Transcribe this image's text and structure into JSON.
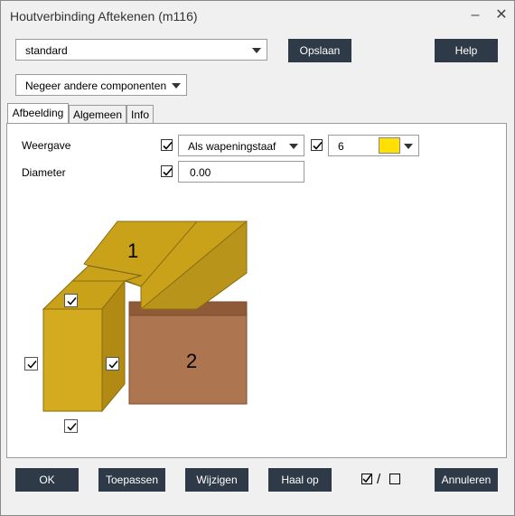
{
  "window": {
    "title": "Houtverbinding Aftekenen (m116)"
  },
  "titlebar": {
    "minimize_glyph": "‒",
    "close_glyph": "✕"
  },
  "top": {
    "preset_value": "standard",
    "save_label": "Opslaan",
    "help_label": "Help",
    "ignore_value": "Negeer andere componenten"
  },
  "tabs": [
    {
      "label": "Afbeelding"
    },
    {
      "label": "Algemeen"
    },
    {
      "label": "Info"
    }
  ],
  "form": {
    "weergave_label": "Weergave",
    "weergave_value": "Als wapeningstaaf",
    "weergave_checked": true,
    "color_checked": true,
    "color_value": "6",
    "color_swatch": "#ffe000",
    "diameter_label": "Diameter",
    "diameter_checked": true,
    "diameter_value": "0.00"
  },
  "diagram": {
    "part1_label": "1",
    "part2_label": "2",
    "colors": {
      "top": "#c9a21a",
      "front": "#d4aa1e",
      "side": "#b08a12",
      "beam2_front": "#ad7550",
      "beam2_top": "#8f5a38"
    }
  },
  "bottom": {
    "ok_label": "OK",
    "apply_label": "Toepassen",
    "modify_label": "Wijzigen",
    "get_label": "Haal op",
    "toggle_separator": "/",
    "cancel_label": "Annuleren"
  }
}
